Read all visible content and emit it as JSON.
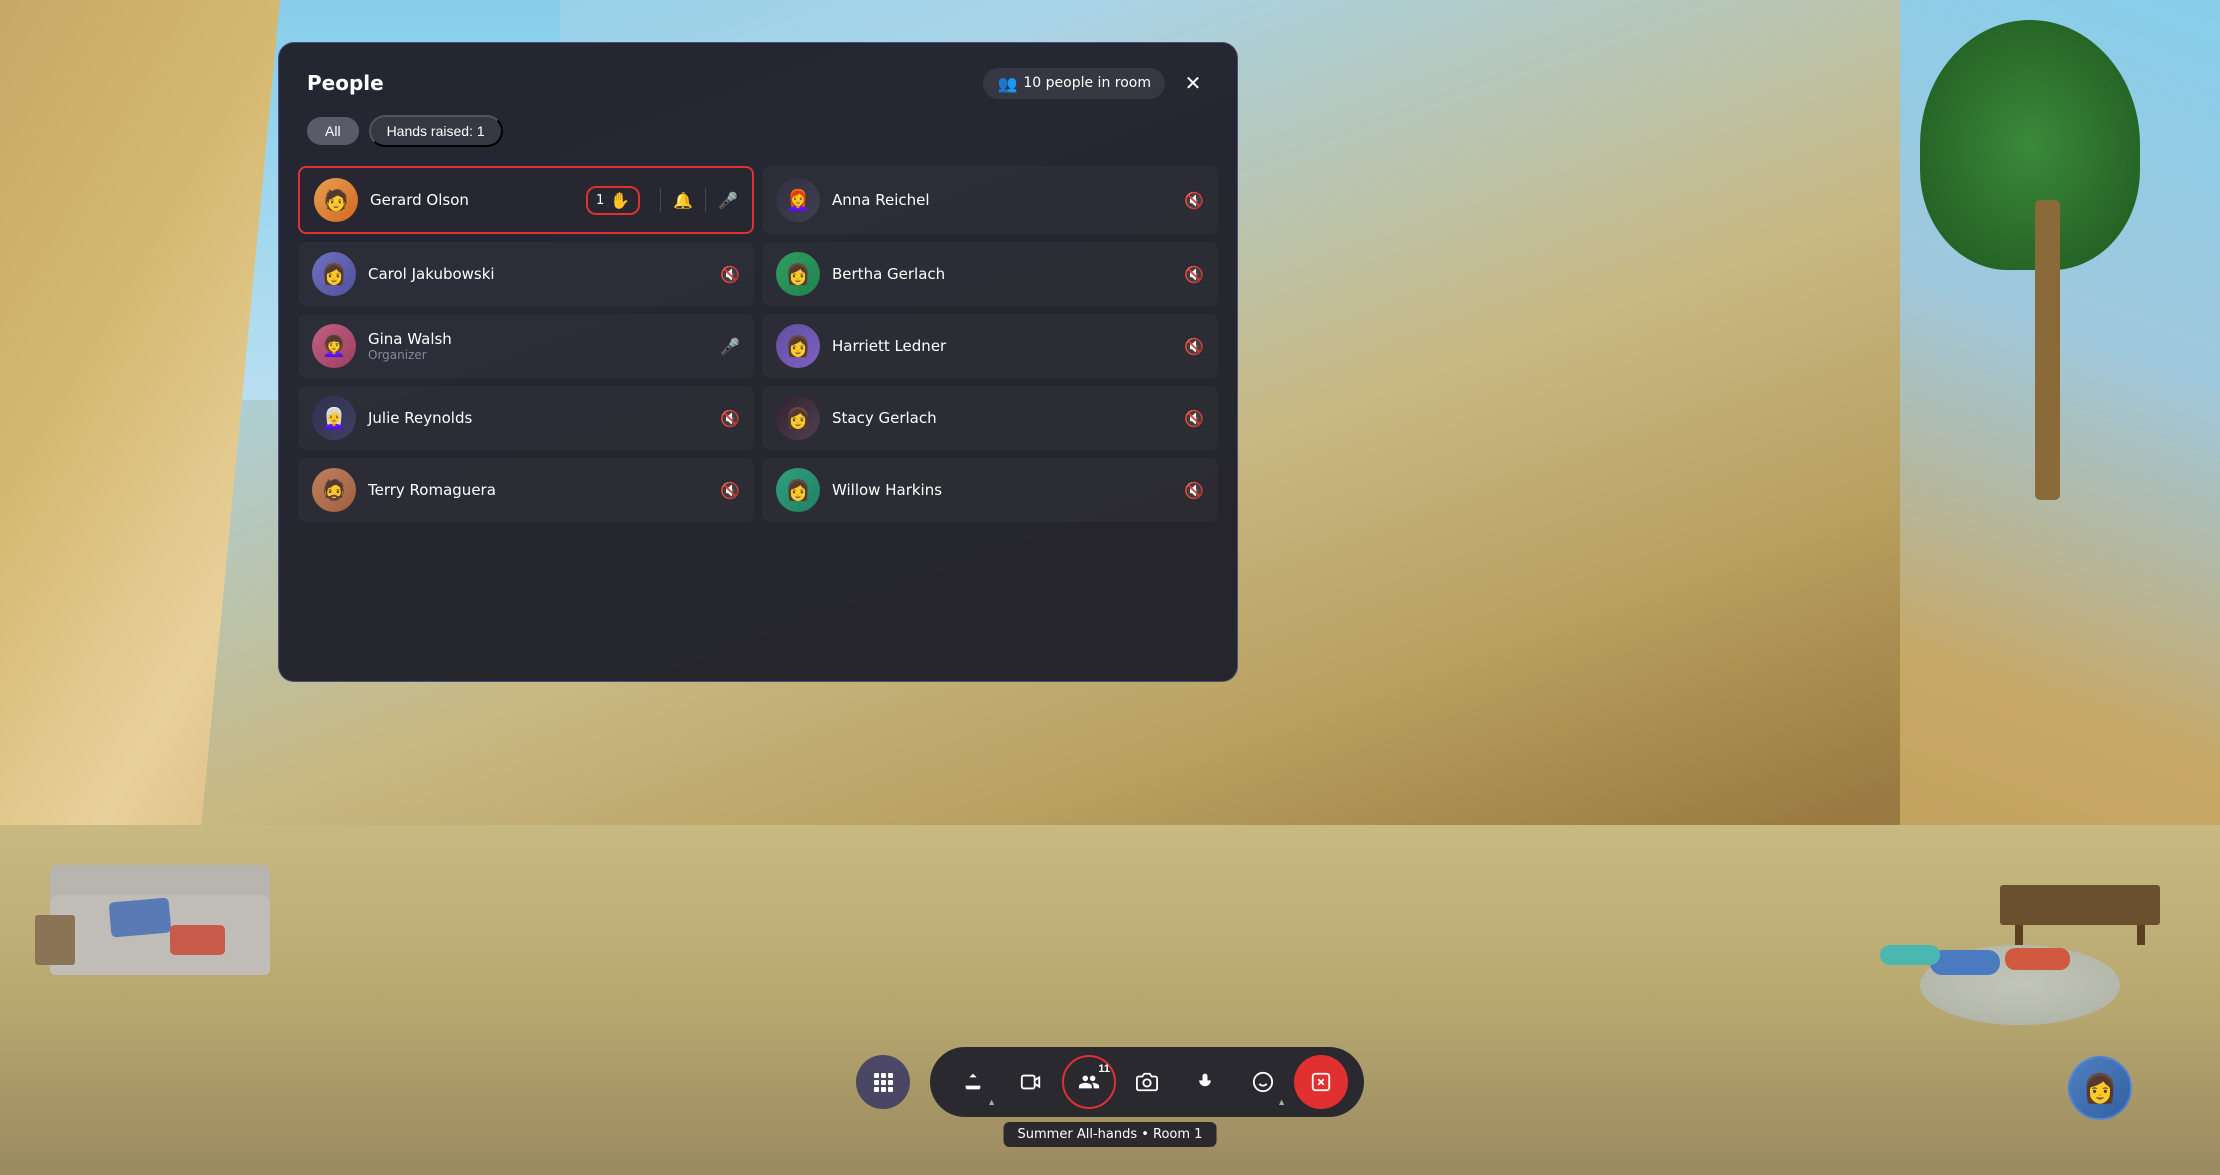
{
  "background": {
    "desc": "VR meeting room background with architectural curves, trees, and outdoor landscape"
  },
  "panel": {
    "title": "People",
    "people_count_label": "10 people in room",
    "close_label": "✕",
    "filters": {
      "all_label": "All",
      "hands_raised_label": "Hands raised: 1"
    },
    "people": [
      {
        "id": "gerard",
        "name": "Gerard Olson",
        "role": "",
        "avatar_emoji": "🧑",
        "avatar_class": "avatar-gerard",
        "hand_raised": true,
        "hand_count": "1",
        "has_bell": true,
        "mic_active": true,
        "side": "left"
      },
      {
        "id": "anna",
        "name": "Anna Reichel",
        "role": "",
        "avatar_emoji": "👩",
        "avatar_class": "avatar-anna",
        "hand_raised": false,
        "mic_active": false,
        "side": "right"
      },
      {
        "id": "carol",
        "name": "Carol Jakubowski",
        "role": "",
        "avatar_emoji": "👩",
        "avatar_class": "avatar-carol",
        "hand_raised": false,
        "mic_active": false,
        "side": "left"
      },
      {
        "id": "bertha",
        "name": "Bertha Gerlach",
        "role": "",
        "avatar_emoji": "👩",
        "avatar_class": "avatar-bertha",
        "hand_raised": false,
        "mic_active": false,
        "side": "right"
      },
      {
        "id": "gina",
        "name": "Gina Walsh",
        "role": "Organizer",
        "avatar_emoji": "👩",
        "avatar_class": "avatar-gina",
        "hand_raised": false,
        "mic_active": true,
        "side": "left"
      },
      {
        "id": "harriett",
        "name": "Harriett Ledner",
        "role": "",
        "avatar_emoji": "👩",
        "avatar_class": "avatar-harriett",
        "hand_raised": false,
        "mic_active": false,
        "side": "right"
      },
      {
        "id": "julie",
        "name": "Julie Reynolds",
        "role": "",
        "avatar_emoji": "👩",
        "avatar_class": "avatar-julie",
        "hand_raised": false,
        "mic_active": false,
        "side": "left"
      },
      {
        "id": "stacy",
        "name": "Stacy Gerlach",
        "role": "",
        "avatar_emoji": "👩",
        "avatar_class": "avatar-stacy",
        "hand_raised": false,
        "mic_active": false,
        "side": "right"
      },
      {
        "id": "terry",
        "name": "Terry Romaguera",
        "role": "",
        "avatar_emoji": "🧔",
        "avatar_class": "avatar-terry",
        "hand_raised": false,
        "mic_active": false,
        "side": "left"
      },
      {
        "id": "willow",
        "name": "Willow Harkins",
        "role": "",
        "avatar_emoji": "👩",
        "avatar_class": "avatar-willow",
        "hand_raised": false,
        "mic_active": false,
        "side": "right"
      }
    ]
  },
  "toolbar": {
    "apps_icon": "⠿",
    "share_label": "⬆",
    "video_label": "🎬",
    "people_label": "👥",
    "people_count": "11",
    "camera_label": "📷",
    "mic_label": "🎤",
    "reactions_label": "😊",
    "record_label": "⏺",
    "tooltip_label": "Summer All-hands • Room 1"
  }
}
